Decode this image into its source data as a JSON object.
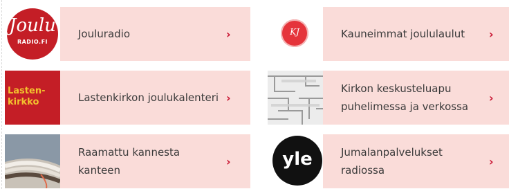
{
  "cards": [
    {
      "label": "Jouluradio",
      "logo": {
        "main": "Joulu",
        "sub": "RADIO.FI"
      },
      "chevron": "›"
    },
    {
      "label": "Kauneimmat joululaulut",
      "logo": {
        "main": "KJ"
      },
      "chevron": "›"
    },
    {
      "label": "Lastenkirkon joulukalenteri",
      "logo": {
        "line1": "Lasten-",
        "line2": "kirkko"
      },
      "chevron": "›"
    },
    {
      "label": "Kirkon keskusteluapu puhelimessa ja verkossa",
      "chevron": "›"
    },
    {
      "label": "Raamattu kannesta kanteen",
      "chevron": "›"
    },
    {
      "label": "Jumalanpalvelukset radiossa",
      "logo": {
        "main": "yle"
      },
      "chevron": "›"
    }
  ],
  "colors": {
    "panel": "#fadcd9",
    "chevron": "#c8102e",
    "brand_red": "#c41e26",
    "text": "#3a3a3a"
  }
}
